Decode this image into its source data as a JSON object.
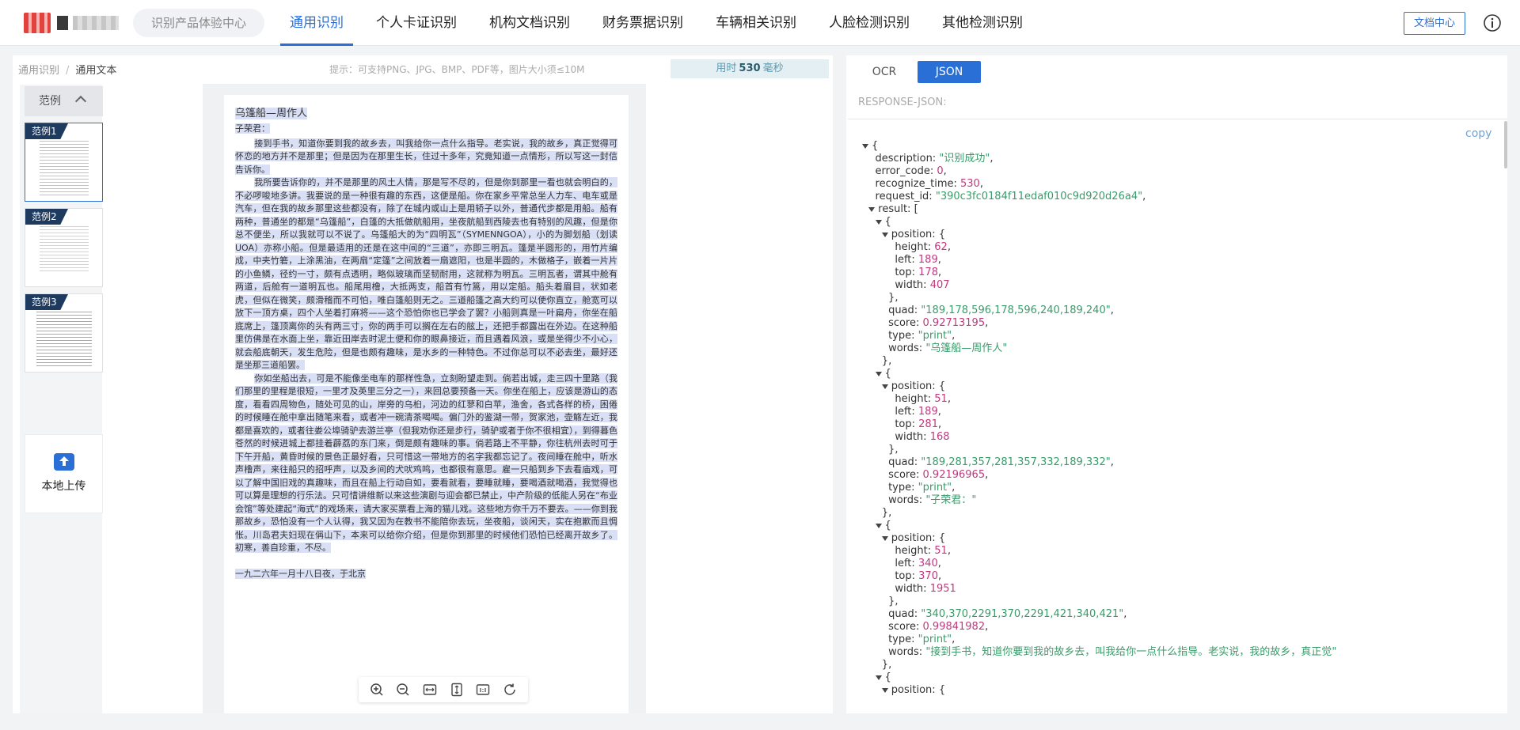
{
  "header": {
    "search_placeholder": "识别产品体验中心",
    "nav": [
      "通用识别",
      "个人卡证识别",
      "机构文档识别",
      "财务票据识别",
      "车辆相关识别",
      "人脸检测识别",
      "其他检测识别"
    ],
    "doc_center": "文档中心"
  },
  "breadcrumb": {
    "root": "通用识别",
    "current": "通用文本"
  },
  "hint": "提示：可支持PNG、JPG、BMP、PDF等，图片大小须≤10M",
  "timing": {
    "prefix": "用时",
    "value": "530",
    "unit": "毫秒"
  },
  "samples": {
    "header": "范例",
    "items": [
      "范例1",
      "范例2",
      "范例3"
    ],
    "upload_label": "本地上传"
  },
  "document": {
    "title": "乌篷船—周作人",
    "salutation": "子荣君：",
    "paragraphs": [
      "接到手书，知道你要到我的故乡去，叫我给你一点什么指导。老实说，我的故乡，真正觉得可怀恋的地方并不是那里；但是因为在那里生长，住过十多年，究竟知道一点情形，所以写这一封信告诉你。",
      "我所要告诉你的，并不是那里的风土人情，那是写不尽的，但是你到那里一看也就会明白的，不必啰唆地多讲。我要说的是一种很有趣的东西，这便是船。你在家乡平常总坐人力车、电车或是汽车，但在我的故乡那里这些都没有，除了在城内或山上是用轿子以外，普通代步都是用船。船有两种，普通坐的都是“乌篷船”，白篷的大抵做航船用，坐夜航船到西陵去也有特别的风趣，但是你总不便坐，所以我就可以不说了。乌篷船大的为“四明瓦”（SYMENNGOA），小的为脚划船（划读UOA）亦称小船。但是最适用的还是在这中间的“三道”，亦即三明瓦。篷是半圆形的，用竹片编成，中夹竹箬，上涂黑油，在两扇“定篷”之间放着一扇遮阳，也是半圆的，木做格子，嵌着一片片的小鱼鳞，径约一寸，颇有点透明，略似玻璃而坚韧耐用，这就称为明瓦。三明瓦者，谓其中舱有两道，后舱有一道明瓦也。船尾用橹，大抵两支，船首有竹篙，用以定船。船头着眉目，状如老虎，但似在微笑，颇滑稽而不可怕，唯白篷船则无之。三道船篷之高大约可以使你直立，舱宽可以放下一顶方桌，四个人坐着打麻将——这个恐怕你也已学会了罢？小船则真是一叶扁舟，你坐在船底席上，篷顶离你的头有两三寸，你的两手可以搁在左右的舷上，还把手都露出在外边。在这种船里仿佛是在水面上坐，靠近田岸去时泥土便和你的眼鼻接近，而且遇着风浪，或是坐得少不小心，就会船底朝天，发生危险，但是也颇有趣味，是水乡的一种特色。不过你总可以不必去坐，最好还是坐那三道船罢。",
      "你如坐船出去，可是不能像坐电车的那样性急，立刻盼望走到。倘若出城，走三四十里路（我们那里的里程是很短，一里才及英里三分之一），来回总要预备一天。你坐在船上，应该是游山的态度，看看四周物色，随处可见的山，岸旁的乌桕，河边的红蓼和白苹，渔舍，各式各样的桥，困倦的时候睡在舱中拿出随笔来看，或者冲一碗清茶喝喝。偏门外的鉴湖一带，贺家池，壶觞左近，我都是喜欢的，或者往娄公埠骑驴去游兰亭（但我劝你还是步行，骑驴或者于你不很相宜），到得暮色苍然的时候进城上都挂着薜荔的东门来，倒是颇有趣味的事。倘若路上不平静，你往杭州去时可于下午开船，黄昏时候的景色正最好看，只可惜这一带地方的名字我都忘记了。夜间睡在舱中，听水声橹声，来往船只的招呼声，以及乡间的犬吠鸡鸣，也都很有意思。雇一只船到乡下去看庙戏，可以了解中国旧戏的真趣味，而且在船上行动自如，要看就看，要睡就睡，要喝酒就喝酒，我觉得也可以算是理想的行乐法。只可惜讲维新以来这些演剧与迎会都已禁止，中产阶级的低能人另在“布业会馆”等处建起“海式”的戏场来，请大家买票看上海的猫儿戏。这些地方你千万不要去。——你到我那故乡，恐怕没有一个人认得，我又因为在教书不能陪你去玩，坐夜船，谈闲天，实在抱歉而且惆怅。川岛君夫妇现在偁山下，本来可以给你介绍，但是你到那里的时候他们恐怕已经离开故乡了。初寒，善自珍重，不尽。"
    ],
    "date": "一九二六年一月十八日夜，于北京"
  },
  "right": {
    "tabs": [
      "OCR",
      "JSON"
    ],
    "response_label": "RESPONSE-JSON:",
    "copy": "copy",
    "json": {
      "description": "识别成功",
      "error_code": "0",
      "recognize_time": "530",
      "request_id": "390c3fc0184f11edaf010c9d920d26a4",
      "results": [
        {
          "height": "62",
          "left": "189",
          "top": "178",
          "width": "407",
          "quad": "189,178,596,178,596,240,189,240",
          "score": "0.92713195",
          "type": "print",
          "words": "乌篷船—周作人"
        },
        {
          "height": "51",
          "left": "189",
          "top": "281",
          "width": "168",
          "quad": "189,281,357,281,357,332,189,332",
          "score": "0.92196965",
          "type": "print",
          "words": "子荣君："
        },
        {
          "height": "51",
          "left": "340",
          "top": "370",
          "width": "1951",
          "quad": "340,370,2291,370,2291,421,340,421",
          "score": "0.99841982",
          "type": "print",
          "words": "接到手书，知道你要到我的故乡去，叫我给你一点什么指导。老实说，我的故乡，真正觉"
        }
      ]
    }
  }
}
